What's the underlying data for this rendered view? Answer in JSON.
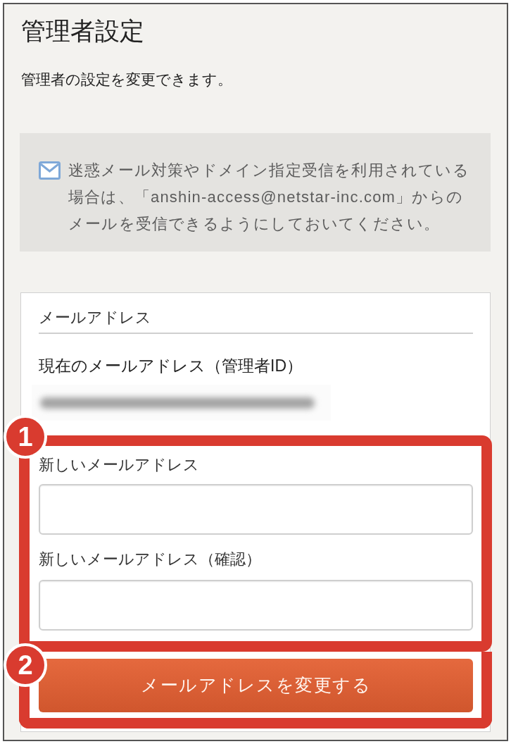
{
  "page": {
    "title": "管理者設定",
    "description": "管理者の設定を変更できます。"
  },
  "notice": {
    "text": "迷惑メール対策やドメイン指定受信を利用されている場合は、「anshin-access@netstar-inc.com」からのメールを受信できるようにしておいてください。"
  },
  "email_section": {
    "heading": "メールアドレス",
    "current_label": "現在のメールアドレス（管理者ID）",
    "fields": [
      {
        "label": "新しいメールアドレス"
      },
      {
        "label": "新しいメールアドレス（確認）"
      }
    ],
    "submit_button": "メールアドレスを変更する"
  },
  "highlights": [
    {
      "number": "1"
    },
    {
      "number": "2"
    }
  ]
}
